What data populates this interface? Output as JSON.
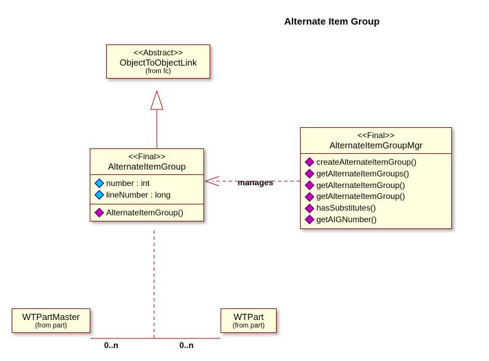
{
  "title": "Alternate Item Group",
  "classes": {
    "objectLink": {
      "stereotype": "<<Abstract>>",
      "name": "ObjectToObjectLink",
      "from": "(from fc)"
    },
    "aig": {
      "stereotype": "<<Final>>",
      "name": "AlternateItemGroup",
      "attrs": [
        {
          "text": "number : int"
        },
        {
          "text": "lineNumber : long"
        }
      ],
      "ops": [
        {
          "text": "AlternateItemGroup()"
        }
      ]
    },
    "mgr": {
      "stereotype": "<<Final>>",
      "name": "AlternateItemGroupMgr",
      "ops": [
        {
          "text": "createAlternateItemGroup()"
        },
        {
          "text": "getAlternateItemGroups()"
        },
        {
          "text": "getAlternateItemGroup()"
        },
        {
          "text": "getAlternateItemGroup()"
        },
        {
          "text": "hasSubstitutes()"
        },
        {
          "text": "getAIGNumber()"
        }
      ]
    },
    "wtpm": {
      "name": "WTPartMaster",
      "from": "(from part)"
    },
    "wtp": {
      "name": "WTPart",
      "from": "(from part)"
    }
  },
  "relations": {
    "managesLabel": "manages",
    "multLeft": "0..n",
    "multRight": "0..n"
  }
}
